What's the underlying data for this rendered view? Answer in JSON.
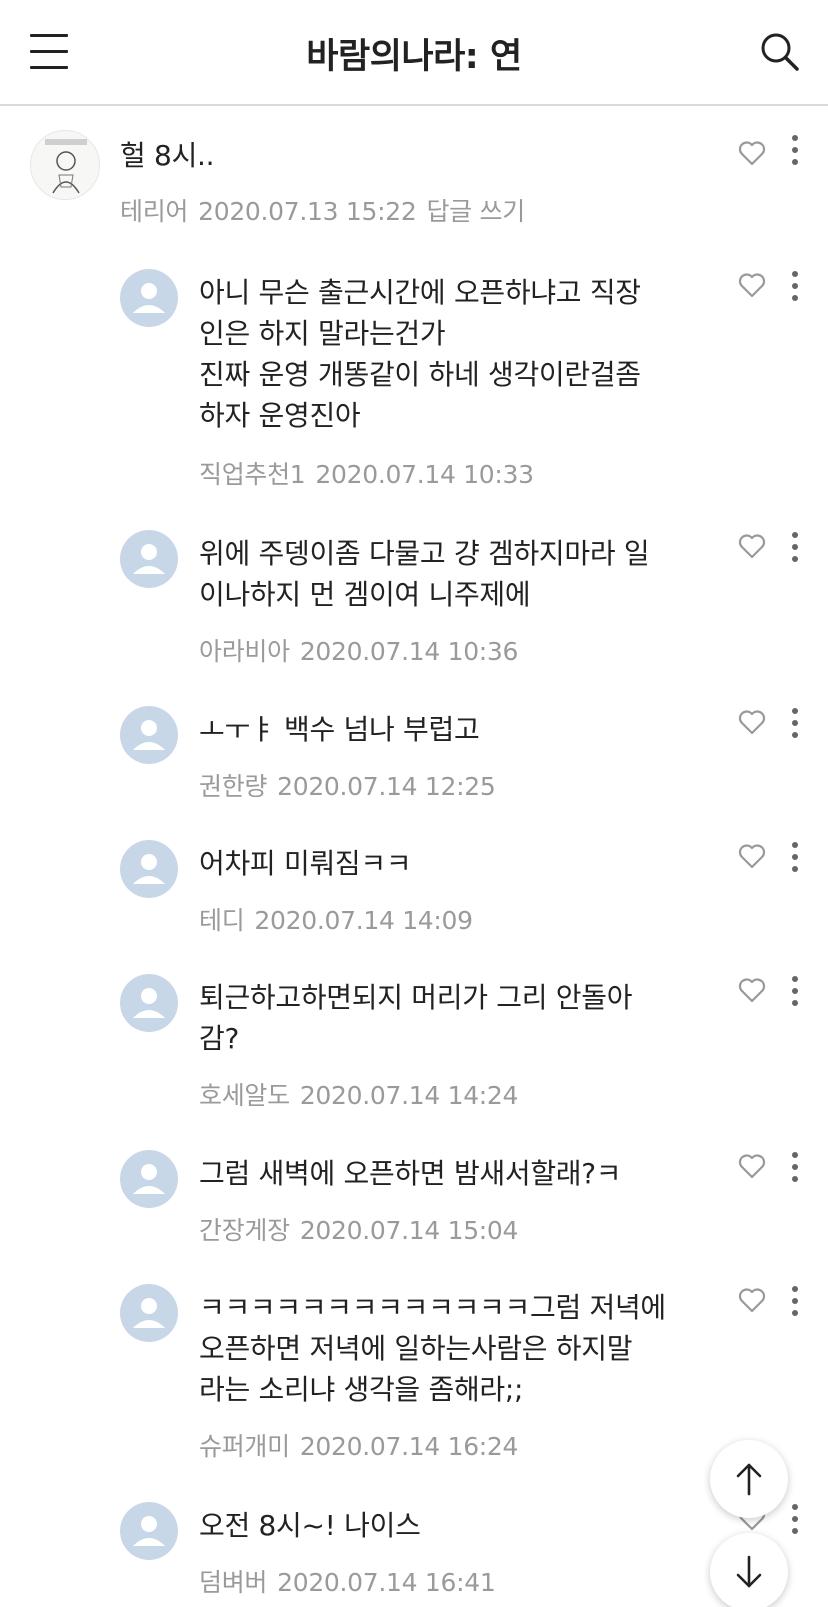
{
  "header": {
    "title": "바람의나라: 연",
    "menu_icon": "hamburger-menu-icon",
    "search_icon": "search-icon"
  },
  "comments": [
    {
      "text": "헐 8시..",
      "author": "테리어",
      "date": "2020.07.13 15:22",
      "reply_label": "답글 쓰기"
    },
    {
      "text": "아니 무슨 출근시간에 오픈하냐고 직장\n인은 하지 말라는건가\n진짜 운영 개똥같이 하네 생각이란걸좀\n하자 운영진아",
      "author": "직업추천1",
      "date": "2020.07.14 10:33"
    },
    {
      "text": "위에 주뎅이좀 다물고 걍 겜하지마라 일\n이나하지 먼 겜이여 니주제에",
      "author": "아라비아",
      "date": "2020.07.14 10:36"
    },
    {
      "text": "ㅗㅜㅑ 백수 넘나 부럽고",
      "author": "권한량",
      "date": "2020.07.14 12:25"
    },
    {
      "text": "어차피 미뤄짐ㅋㅋ",
      "author": "테디",
      "date": "2020.07.14 14:09"
    },
    {
      "text": "퇴근하고하면되지 머리가 그리 안돌아\n감?",
      "author": "호세알도",
      "date": "2020.07.14 14:24"
    },
    {
      "text": "그럼 새벽에 오픈하면 밤새서할래?ㅋ",
      "author": "간장게장",
      "date": "2020.07.14 15:04"
    },
    {
      "text": "ㅋㅋㅋㅋㅋㅋㅋㅋㅋㅋㅋㅋㅋ그럼 저녁에\n오픈하면 저녁에 일하는사람은 하지말\n라는 소리냐 생각을 좀해라;;",
      "author": "슈퍼개미",
      "date": "2020.07.14 16:24"
    },
    {
      "text": "오전 8시~! 나이스",
      "author": "덤벼버",
      "date": "2020.07.14 16:41"
    }
  ],
  "icons": {
    "like": "heart-icon",
    "more": "more-vertical-icon",
    "scroll_up": "arrow-up-icon",
    "scroll_down": "arrow-down-icon"
  },
  "colors": {
    "avatar_placeholder": "#c8d7e8",
    "meta_text": "#9a9a9a",
    "divider": "#d9d9d9"
  }
}
